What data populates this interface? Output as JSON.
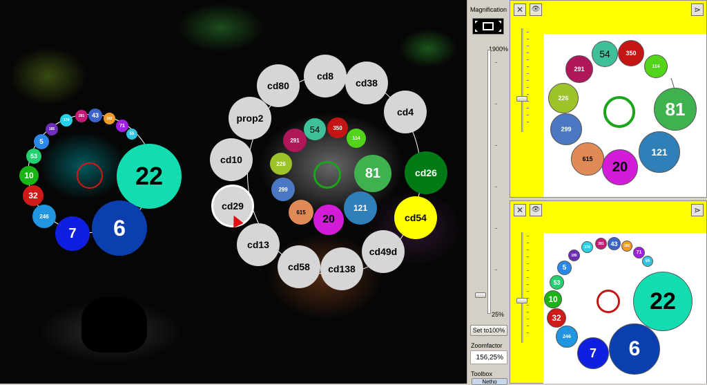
{
  "main_view": {
    "marker_circles": [
      {
        "label": "cd8",
        "bg": "#d6d6d6",
        "fg": "#000000"
      },
      {
        "label": "cd80",
        "bg": "#d6d6d6",
        "fg": "#000000"
      },
      {
        "label": "cd38",
        "bg": "#d6d6d6",
        "fg": "#000000"
      },
      {
        "label": "cd4",
        "bg": "#d6d6d6",
        "fg": "#000000"
      },
      {
        "label": "prop2",
        "bg": "#d6d6d6",
        "fg": "#000000"
      },
      {
        "label": "cd10",
        "bg": "#d6d6d6",
        "fg": "#000000"
      },
      {
        "label": "cd26",
        "bg": "#007a14",
        "fg": "#ffffff"
      },
      {
        "label": "cd29",
        "bg": "#d6d6d6",
        "fg": "#000000"
      },
      {
        "label": "cd54",
        "bg": "#ffff00",
        "fg": "#000000"
      },
      {
        "label": "cd13",
        "bg": "#d6d6d6",
        "fg": "#000000"
      },
      {
        "label": "cd58",
        "bg": "#d6d6d6",
        "fg": "#000000"
      },
      {
        "label": "cd138",
        "bg": "#d6d6d6",
        "fg": "#000000"
      },
      {
        "label": "cd49d",
        "bg": "#d6d6d6",
        "fg": "#000000"
      }
    ],
    "inner_circles": [
      {
        "label": "54",
        "bg": "#3fbf9a",
        "fg": "#000000"
      },
      {
        "label": "350",
        "bg": "#c41414",
        "fg": "#ffffff"
      },
      {
        "label": "291",
        "bg": "#b0165a",
        "fg": "#ffffff"
      },
      {
        "label": "114",
        "bg": "#52d41a",
        "fg": "#ffffff"
      },
      {
        "label": "226",
        "bg": "#9ec22a",
        "fg": "#ffffff"
      },
      {
        "label": "81",
        "bg": "#3fb24f",
        "fg": "#ffffff"
      },
      {
        "label": "299",
        "bg": "#4a78c4",
        "fg": "#ffffff"
      },
      {
        "label": "615",
        "bg": "#e08a56",
        "fg": "#000000"
      },
      {
        "label": "121",
        "bg": "#2f7fb8",
        "fg": "#ffffff"
      },
      {
        "label": "20",
        "bg": "#d21cd8",
        "fg": "#000000"
      }
    ],
    "left_circles": [
      {
        "label": "22",
        "bg": "#12dcb0",
        "fg": "#000000"
      },
      {
        "label": "6",
        "bg": "#0b3fb0",
        "fg": "#ffffff"
      },
      {
        "label": "7",
        "bg": "#0f1fe0",
        "fg": "#ffffff"
      },
      {
        "label": "246",
        "bg": "#2196e0",
        "fg": "#ffffff"
      },
      {
        "label": "32",
        "bg": "#d01a1a",
        "fg": "#ffffff"
      },
      {
        "label": "10",
        "bg": "#18b418",
        "fg": "#ffffff"
      },
      {
        "label": "53",
        "bg": "#22d070",
        "fg": "#ffffff"
      },
      {
        "label": "5",
        "bg": "#2a88e8",
        "fg": "#ffffff"
      },
      {
        "label": "185",
        "bg": "#6e2cb8",
        "fg": "#ffffff"
      },
      {
        "label": "174",
        "bg": "#26d2e8",
        "fg": "#ffffff"
      },
      {
        "label": "281",
        "bg": "#c41c78",
        "fg": "#ffffff"
      },
      {
        "label": "43",
        "bg": "#3a64c8",
        "fg": "#ffffff"
      },
      {
        "label": "182",
        "bg": "#f09a2a",
        "fg": "#ffffff"
      },
      {
        "label": "71",
        "bg": "#a020e0",
        "fg": "#ffffff"
      },
      {
        "label": "55",
        "bg": "#30c4e0",
        "fg": "#ffffff"
      }
    ]
  },
  "sidebar": {
    "magnification_label": "Magnification",
    "max_label": "1900%",
    "min_label": "25%",
    "set_button": "Set to100%",
    "zoom_label": "Zoomfactor",
    "zoom_value": "156,25%",
    "toolbox_label": "Toolbox",
    "toolbox_tab": "Netho"
  },
  "panel_top": {
    "circles": [
      {
        "label": "54",
        "bg": "#3fbf9a",
        "fg": "#000000"
      },
      {
        "label": "350",
        "bg": "#c41414",
        "fg": "#ffffff"
      },
      {
        "label": "291",
        "bg": "#b0165a",
        "fg": "#ffffff"
      },
      {
        "label": "114",
        "bg": "#52d41a",
        "fg": "#ffffff"
      },
      {
        "label": "226",
        "bg": "#9ec22a",
        "fg": "#ffffff"
      },
      {
        "label": "81",
        "bg": "#3fb24f",
        "fg": "#ffffff"
      },
      {
        "label": "299",
        "bg": "#4a78c4",
        "fg": "#ffffff"
      },
      {
        "label": "615",
        "bg": "#e08a56",
        "fg": "#000000"
      },
      {
        "label": "121",
        "bg": "#2f7fb8",
        "fg": "#ffffff"
      },
      {
        "label": "20",
        "bg": "#d21cd8",
        "fg": "#000000"
      }
    ],
    "center_ring_color": "#1aa51a"
  },
  "panel_bottom": {
    "circles": [
      {
        "label": "22",
        "bg": "#12dcb0",
        "fg": "#000000"
      },
      {
        "label": "6",
        "bg": "#0b3fb0",
        "fg": "#ffffff"
      },
      {
        "label": "7",
        "bg": "#0f1fe0",
        "fg": "#ffffff"
      },
      {
        "label": "246",
        "bg": "#2196e0",
        "fg": "#ffffff"
      },
      {
        "label": "32",
        "bg": "#d01a1a",
        "fg": "#ffffff"
      },
      {
        "label": "10",
        "bg": "#18b418",
        "fg": "#ffffff"
      },
      {
        "label": "53",
        "bg": "#22d070",
        "fg": "#ffffff"
      },
      {
        "label": "5",
        "bg": "#2a88e8",
        "fg": "#ffffff"
      },
      {
        "label": "185",
        "bg": "#6e2cb8",
        "fg": "#ffffff"
      },
      {
        "label": "174",
        "bg": "#26d2e8",
        "fg": "#ffffff"
      },
      {
        "label": "281",
        "bg": "#c41c78",
        "fg": "#ffffff"
      },
      {
        "label": "43",
        "bg": "#3a64c8",
        "fg": "#ffffff"
      },
      {
        "label": "182",
        "bg": "#f09a2a",
        "fg": "#ffffff"
      },
      {
        "label": "71",
        "bg": "#a020e0",
        "fg": "#ffffff"
      },
      {
        "label": "55",
        "bg": "#30c4e0",
        "fg": "#ffffff"
      }
    ],
    "center_ring_color": "#c41414"
  },
  "icons": {
    "close": "✕",
    "eye": "👁",
    "next": "⋗"
  }
}
